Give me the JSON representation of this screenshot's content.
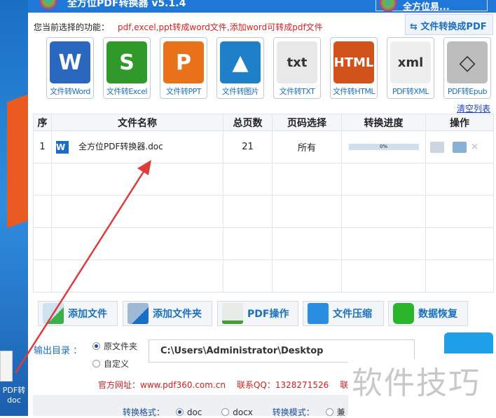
{
  "app": {
    "title": "全方位PDF转换器 v5.1.4",
    "account": "全方位易..."
  },
  "function_label": "您当前选择的功能：",
  "function_value": "pdf,excel,ppt转成word文件,添加word可转成pdf文件",
  "convert_button": "文件转换成PDF",
  "tools": [
    {
      "label": "文件转Word",
      "icon": "word-icon",
      "glyph": "W",
      "color": "#2a68c0"
    },
    {
      "label": "文件转Excel",
      "icon": "excel-icon",
      "glyph": "S",
      "color": "#2f9a2a"
    },
    {
      "label": "文件转PPT",
      "icon": "ppt-icon",
      "glyph": "P",
      "color": "#e8711a"
    },
    {
      "label": "文件转图片",
      "icon": "image-icon",
      "glyph": "▲",
      "color": "#1f7fc8"
    },
    {
      "label": "文件转TXT",
      "icon": "txt-icon",
      "glyph": "txt",
      "color": "#e8e8e8"
    },
    {
      "label": "文件转HTML",
      "icon": "html-icon",
      "glyph": "HTML",
      "color": "#d2521c"
    },
    {
      "label": "PDF转XML",
      "icon": "xml-icon",
      "glyph": "xml",
      "color": "#eeeeee"
    },
    {
      "label": "PDF转Epub",
      "icon": "epub-icon",
      "glyph": "◇",
      "color": "#bdbdbd"
    }
  ],
  "clear_list": "清空列表",
  "table": {
    "headers": [
      "序",
      "文件名称",
      "总页数",
      "页码选择",
      "转换进度",
      "操作"
    ],
    "rows": [
      {
        "index": "1",
        "name": "全方位PDF转换器.doc",
        "pages": "21",
        "range": "所有",
        "progress": "0%",
        "progress_value": 0
      }
    ]
  },
  "buttons": [
    "添加文件",
    "添加文件夹",
    "PDF操作",
    "文件压缩",
    "数据恢复"
  ],
  "output": {
    "label": "输出目录 ：",
    "opt1": "原文件夹",
    "opt2": "自定义",
    "path": "C:\\Users\\Administrator\\Desktop"
  },
  "footer": {
    "site": "官方网址：www.pdf360.com.cn",
    "qq": "联系QQ：1328271526",
    "more": "联系"
  },
  "format": {
    "label": "转换格式：",
    "doc": "doc",
    "docx": "docx",
    "mode_label": "转换模式：",
    "mode1": "兼"
  },
  "desktop_icon": {
    "line1": "PDF转",
    "line2": "doc"
  },
  "watermark": "软件技巧"
}
